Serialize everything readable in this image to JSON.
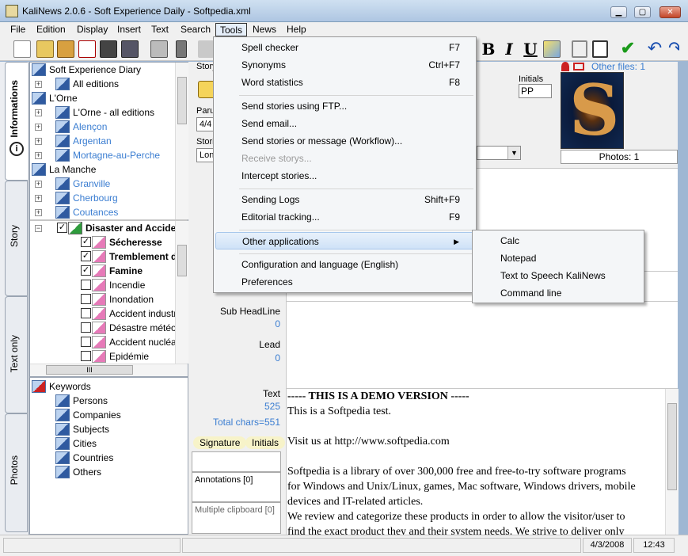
{
  "window": {
    "title": "KaliNews 2.0.6 - Soft Experience Daily - Softpedia.xml"
  },
  "menubar": [
    "File",
    "Edition",
    "Display",
    "Insert",
    "Text",
    "Search",
    "Tools",
    "News",
    "Help"
  ],
  "sidetabs": [
    "Informations",
    "Story",
    "Text only",
    "Photos"
  ],
  "tree": {
    "items": [
      {
        "label": "Soft Experience Diary"
      },
      {
        "label": "All editions"
      },
      {
        "label": "L'Orne"
      },
      {
        "label": "L'Orne - all editions"
      },
      {
        "label": "Alençon"
      },
      {
        "label": "Argentan"
      },
      {
        "label": "Mortagne-au-Perche"
      },
      {
        "label": "La Manche"
      },
      {
        "label": "Granville"
      },
      {
        "label": "Cherbourg"
      },
      {
        "label": "Coutances"
      }
    ],
    "categories": [
      {
        "label": "Disaster and Accidents"
      },
      {
        "label": "Sécheresse"
      },
      {
        "label": "Tremblement de terre"
      },
      {
        "label": "Famine"
      },
      {
        "label": "Incendie"
      },
      {
        "label": "Inondation"
      },
      {
        "label": "Accident industriel"
      },
      {
        "label": "Désastre météorologique"
      },
      {
        "label": "Accident nucléaire"
      },
      {
        "label": "Epidémie"
      }
    ],
    "scroll_label": "III"
  },
  "keywords": {
    "root": "Keywords",
    "items": [
      "Persons",
      "Companies",
      "Subjects",
      "Cities",
      "Countries",
      "Others"
    ]
  },
  "mid": {
    "story_label": "Story",
    "parution_label": "Parution",
    "parution_value": "4/4",
    "stories_label": "Stories",
    "stories_value": "Lon",
    "subheadline_label": "Sub HeadLine",
    "subheadline_count": "0",
    "lead_label": "Lead",
    "lead_count": "0",
    "text_label": "Text",
    "text_count": "525",
    "total_chars": "Total chars=551",
    "signature_btn": "Signature",
    "initials_btn": "Initials",
    "annotations": "Annotations [0]",
    "clipboard": "Multiple clipboard [0]"
  },
  "info": {
    "initials_label": "Initials",
    "initials_value": "PP",
    "other_files": "Other files: 1",
    "photos": "Photos: 1"
  },
  "text_lines": [
    "----- THIS IS A DEMO VERSION -----",
    "This is a Softpedia test.",
    "",
    "Visit us at http://www.softpedia.com",
    "",
    "Softpedia is a library of over 300,000 free and free-to-try software programs",
    "for Windows and Unix/Linux, games, Mac software, Windows drivers, mobile",
    "devices and IT-related articles.",
    "We review and categorize these products in order to allow the visitor/user to",
    "find the exact product they and their system needs. We strive to deliver only"
  ],
  "tools_menu": [
    {
      "label": "Spell checker",
      "shortcut": "F7"
    },
    {
      "label": "Synonyms",
      "shortcut": "Ctrl+F7"
    },
    {
      "label": "Word statistics",
      "shortcut": "F8"
    },
    {
      "label": "Send stories using FTP...",
      "shortcut": ""
    },
    {
      "label": "Send email...",
      "shortcut": ""
    },
    {
      "label": "Send stories or message (Workflow)...",
      "shortcut": ""
    },
    {
      "label": "Receive storys...",
      "shortcut": ""
    },
    {
      "label": "Intercept stories...",
      "shortcut": ""
    },
    {
      "label": "Sending Logs",
      "shortcut": "Shift+F9"
    },
    {
      "label": "Editorial tracking...",
      "shortcut": "F9"
    },
    {
      "label": "Other applications",
      "shortcut": ""
    },
    {
      "label": "Configuration and language (English)",
      "shortcut": ""
    },
    {
      "label": "Preferences",
      "shortcut": ""
    }
  ],
  "submenu": [
    "Calc",
    "Notepad",
    "Text to Speech KaliNews",
    "Command line"
  ],
  "toolbar": {
    "bold": "B",
    "italic": "I",
    "underline": "U"
  },
  "status": {
    "date": "4/3/2008",
    "time": "12:43"
  },
  "colors": {
    "link": "#3a7dd1",
    "menu_highlight": "#cfe2f7"
  }
}
